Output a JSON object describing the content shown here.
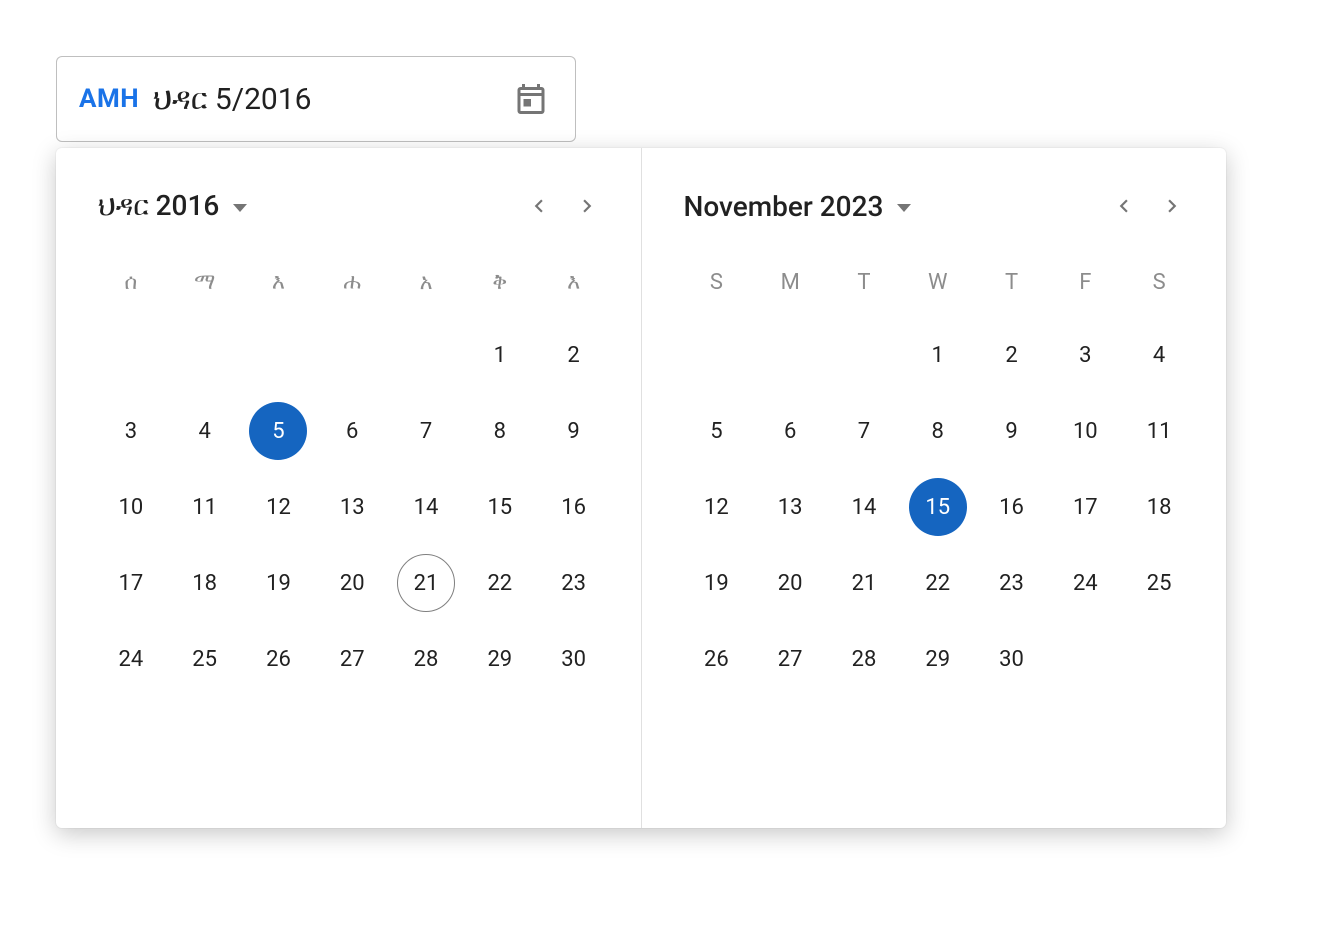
{
  "input": {
    "prefix": "AMH",
    "value": "ህዳር 5/2016"
  },
  "left": {
    "month_label": "ህዳር 2016",
    "dow": [
      "ሰ",
      "ማ",
      "እ",
      "ሐ",
      "አ",
      "ቅ",
      "እ"
    ],
    "weeks": [
      [
        "",
        "",
        "",
        "",
        "",
        "1",
        "2"
      ],
      [
        "3",
        "4",
        "5",
        "6",
        "7",
        "8",
        "9"
      ],
      [
        "10",
        "11",
        "12",
        "13",
        "14",
        "15",
        "16"
      ],
      [
        "17",
        "18",
        "19",
        "20",
        "21",
        "22",
        "23"
      ],
      [
        "24",
        "25",
        "26",
        "27",
        "28",
        "29",
        "30"
      ]
    ],
    "selected": "5",
    "today": "21"
  },
  "right": {
    "month_label": "November 2023",
    "dow": [
      "S",
      "M",
      "T",
      "W",
      "T",
      "F",
      "S"
    ],
    "weeks": [
      [
        "",
        "",
        "",
        "1",
        "2",
        "3",
        "4"
      ],
      [
        "5",
        "6",
        "7",
        "8",
        "9",
        "10",
        "11"
      ],
      [
        "12",
        "13",
        "14",
        "15",
        "16",
        "17",
        "18"
      ],
      [
        "19",
        "20",
        "21",
        "22",
        "23",
        "24",
        "25"
      ],
      [
        "26",
        "27",
        "28",
        "29",
        "30",
        "",
        ""
      ]
    ],
    "selected": "15",
    "today": ""
  },
  "colors": {
    "accent": "#1a73e8",
    "selected_bg": "#1565c0"
  }
}
